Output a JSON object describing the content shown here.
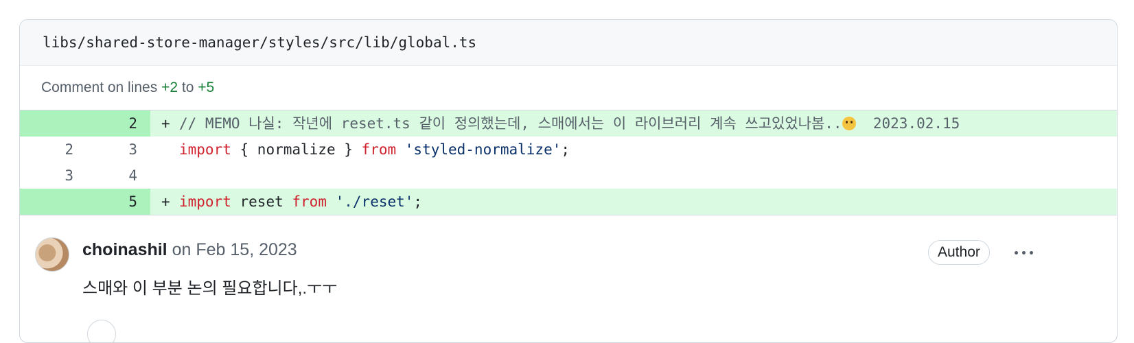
{
  "file": {
    "path": "libs/shared-store-manager/styles/src/lib/global.ts"
  },
  "comment_range": {
    "prefix": "Comment on lines",
    "start": "+2",
    "connector": "to",
    "end": "+5"
  },
  "diff": {
    "rows": [
      {
        "type": "add",
        "old": "",
        "new": "2",
        "marker": "+",
        "comment": "// MEMO 나실: 작년에 reset.ts 같이 정의했는데, 스매에서는 이 라이브러리 계속 쓰고있었나봄..",
        "comment_suffix": "2023.02.15"
      },
      {
        "type": "context",
        "old": "2",
        "new": "3",
        "marker": "",
        "tokens": [
          "import",
          "{ normalize }",
          "from",
          "'styled-normalize'",
          ";"
        ]
      },
      {
        "type": "context",
        "old": "3",
        "new": "4",
        "marker": ""
      },
      {
        "type": "add",
        "old": "",
        "new": "5",
        "marker": "+",
        "tokens": [
          "import",
          "reset",
          "from",
          "'./reset'",
          ";"
        ]
      }
    ]
  },
  "comment": {
    "author": "choinashil",
    "date_prefix": "on",
    "date": "Feb 15, 2023",
    "badge": "Author",
    "body": "스매와 이 부분 논의 필요합니다,.ㅜㅜ"
  },
  "icons": {
    "emoji": "grimacing-face-icon",
    "menu": "kebab-horizontal-icon"
  },
  "colors": {
    "addition_bg": "#dafbe1",
    "addition_num_bg": "#abf2bc",
    "keyword": "#cf222e",
    "string": "#0a3069",
    "plus": "#1a7f37"
  }
}
